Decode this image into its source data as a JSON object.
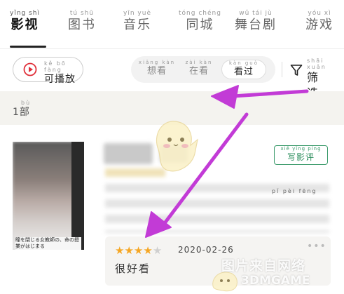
{
  "tabs": [
    {
      "pinyin": "yǐng shì",
      "label": "影视",
      "active": true
    },
    {
      "pinyin": "tú shū",
      "label": "图书"
    },
    {
      "pinyin": "yīn yuè",
      "label": "音乐"
    },
    {
      "pinyin": "tóng chéng",
      "label": "同城"
    },
    {
      "pinyin": "wǔ tái jù",
      "label": "舞台剧"
    },
    {
      "pinyin": "yóu xì",
      "label": "游戏"
    }
  ],
  "toolbar": {
    "play_pinyin": "kě bō fàng",
    "play_label": "可播放",
    "segments": [
      {
        "pinyin": "xiǎng kàn",
        "label": "想看"
      },
      {
        "pinyin": "zài kàn",
        "label": "在看"
      },
      {
        "pinyin": "kàn guò",
        "label": "看过",
        "active": true
      }
    ],
    "filter_pinyin": "shāi xuǎn",
    "filter_label": "筛选"
  },
  "section": {
    "pinyin": "bù",
    "count_label": "1部"
  },
  "item": {
    "poster_caption": "瞳を閉じる女教師の、命の授業がはじまる",
    "review_pinyin": "xiě yǐng píng",
    "review_label": "写影评",
    "pinyin_row": "pǐ pèi fēng",
    "rating": 4,
    "rating_max": 5,
    "date": "2020-02-26",
    "comment": "很好看",
    "more": "•••"
  },
  "watermark": {
    "line1": "图片来自网络",
    "line2": "3DMGAME"
  },
  "colors": {
    "accent_green": "#2f8f5f",
    "annotation": "#c23bd6",
    "star": "#f5a623",
    "play_red": "#e0303a"
  }
}
